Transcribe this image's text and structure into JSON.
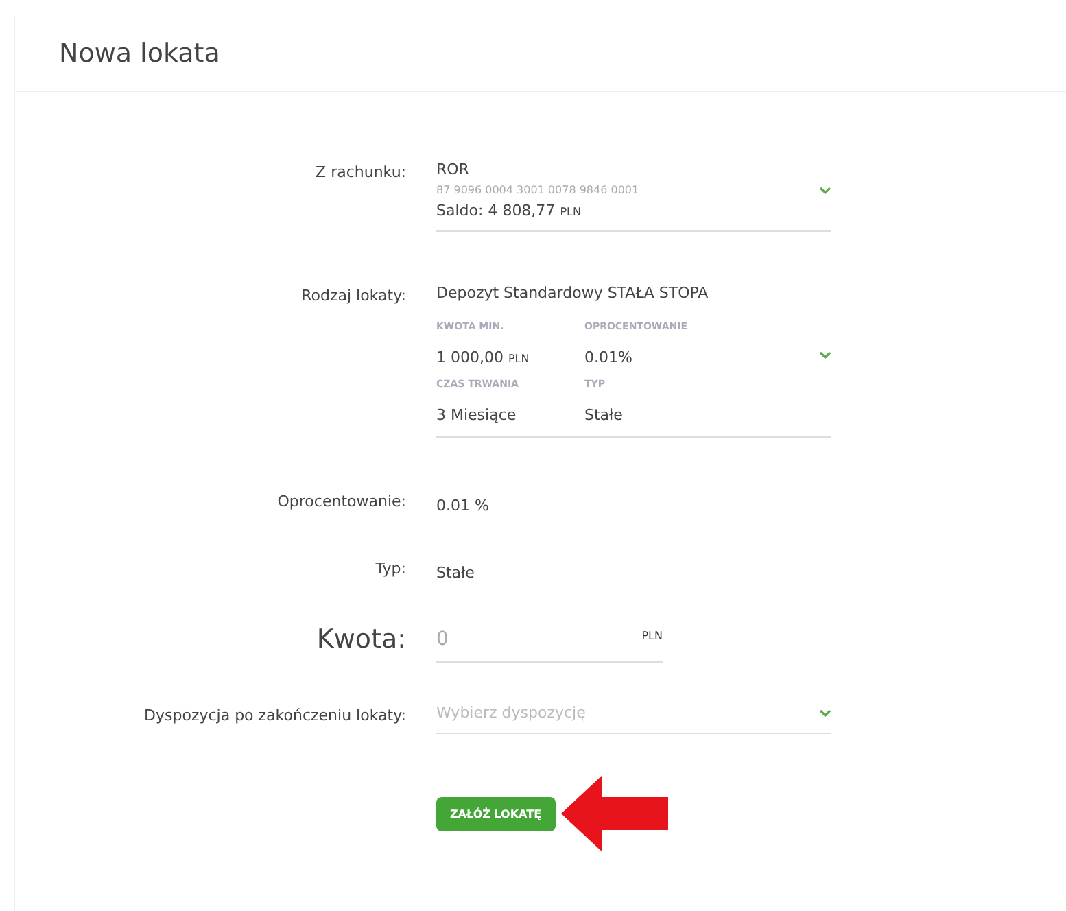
{
  "title": "Nowa lokata",
  "fields": [
    {
      "kind": "account",
      "label": "Z rachunku:",
      "name": "ROR",
      "number": "87 9096 0004 3001 0078 9846 0001",
      "balance_label": "Saldo: 4 808,77",
      "balance_currency": "PLN"
    },
    {
      "kind": "deposit",
      "label": "Rodzaj lokaty:",
      "name": "Depozyt Standardowy STAŁA STOPA",
      "details": [
        {
          "caption": "KWOTA MIN.",
          "value": "1 000,00",
          "currency": "PLN"
        },
        {
          "caption": "OPROCENTOWANIE",
          "value": "0.01%"
        },
        {
          "caption": "CZAS TRWANIA",
          "value": "3 Miesiące"
        },
        {
          "caption": "TYP",
          "value": "Stałe"
        }
      ]
    },
    {
      "kind": "text",
      "label": "Oprocentowanie:",
      "value": "0.01 %"
    },
    {
      "kind": "text",
      "label": "Typ:",
      "value": "Stałe"
    },
    {
      "kind": "amount",
      "label": "Kwota:",
      "placeholder": "0",
      "currency": "PLN"
    },
    {
      "kind": "select",
      "label": "Dyspozycja po zakończeniu lokaty:",
      "placeholder": "Wybierz dyspozycję"
    }
  ],
  "submit": {
    "label": "ZAŁÓŻ LOKATĘ"
  }
}
